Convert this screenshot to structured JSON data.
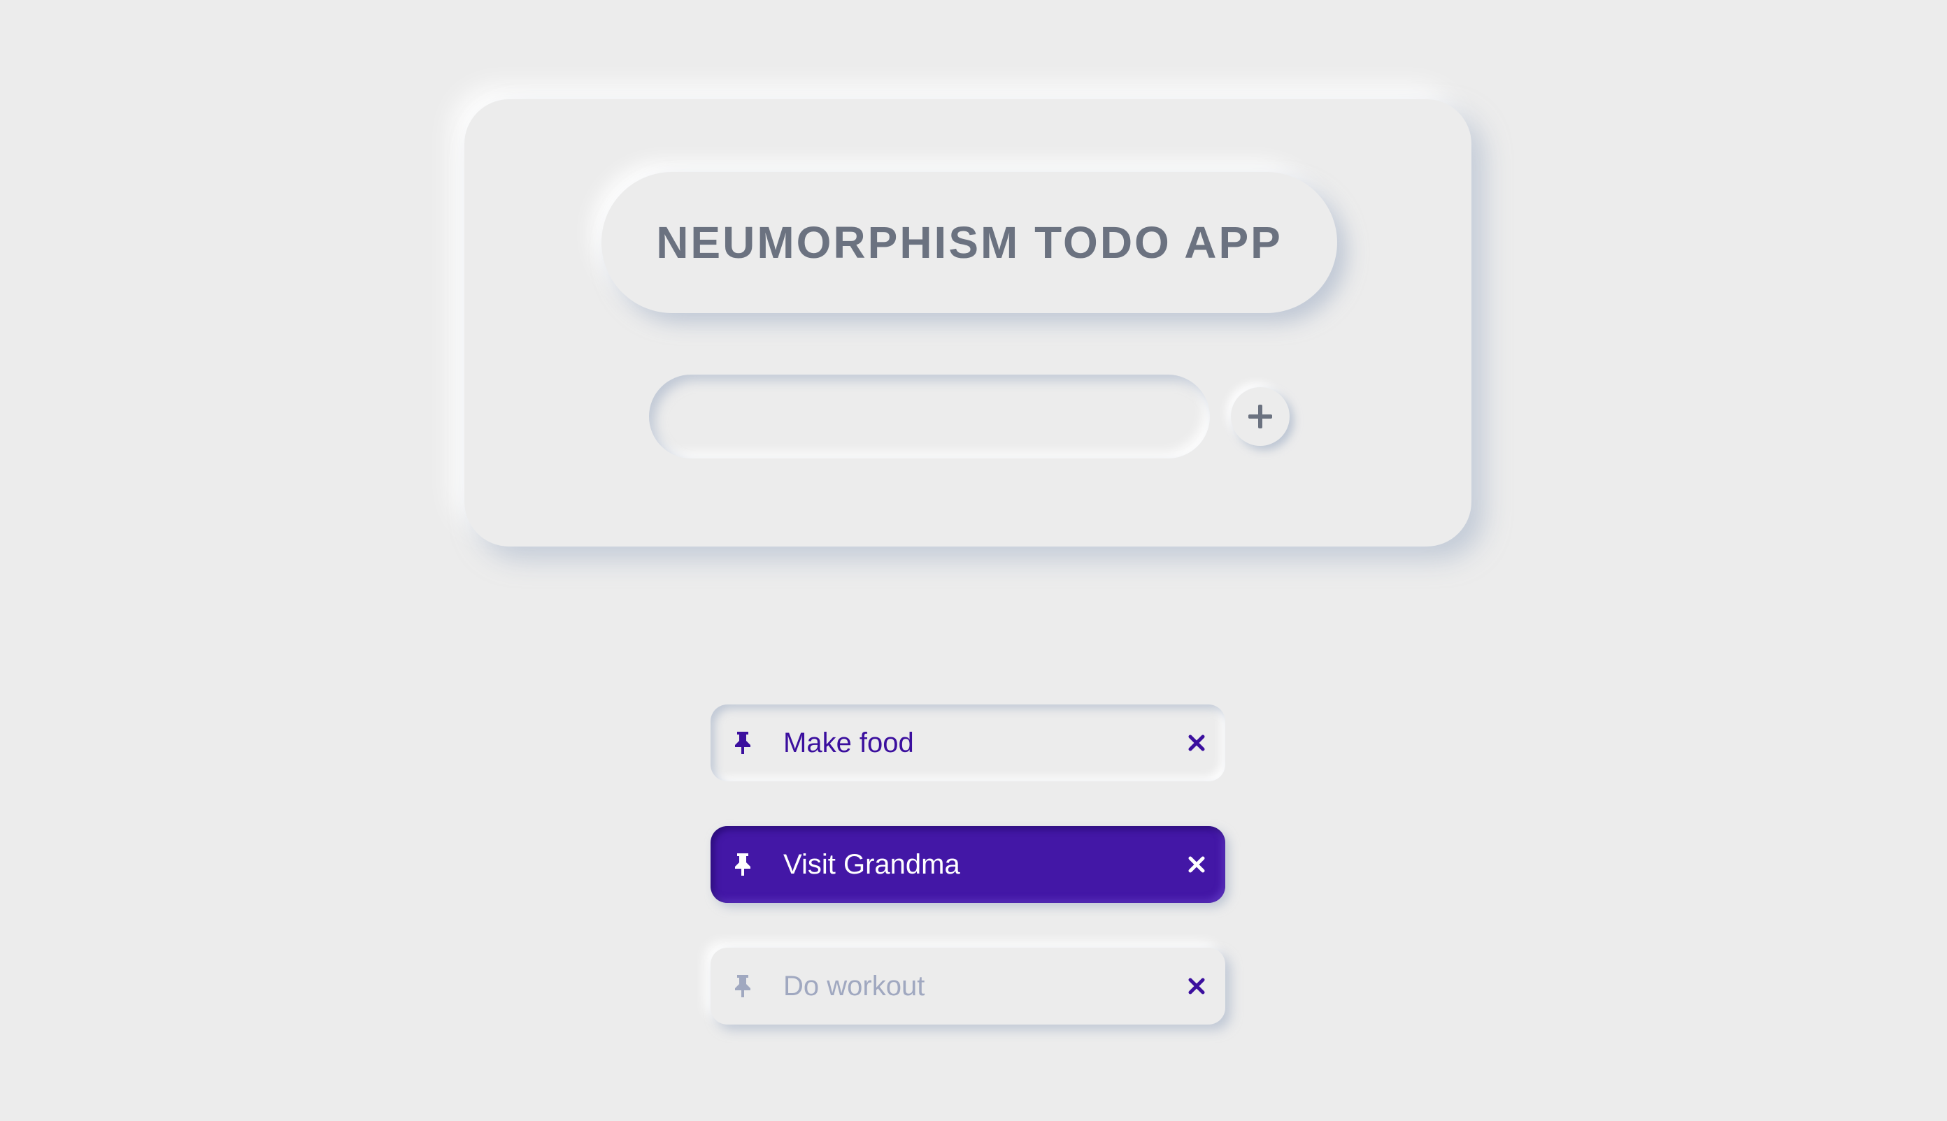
{
  "app": {
    "title": "NEUMORPHISM TODO APP"
  },
  "input": {
    "value": "",
    "placeholder": ""
  },
  "add_button": {
    "icon": "plus-icon"
  },
  "todos": [
    {
      "text": "Make food",
      "state": "pressed",
      "pin_icon": "pin-icon",
      "delete_icon": "close-icon"
    },
    {
      "text": "Visit Grandma",
      "state": "active",
      "pin_icon": "pin-icon",
      "delete_icon": "close-icon"
    },
    {
      "text": "Do workout",
      "state": "completed",
      "pin_icon": "pin-icon",
      "delete_icon": "close-icon"
    }
  ],
  "colors": {
    "background": "#ececec",
    "title_text": "#6b7280",
    "accent": "#4317a6",
    "todo_text": "#3b0f9e",
    "completed_text": "#a0a8c0",
    "active_text": "#ffffff"
  }
}
